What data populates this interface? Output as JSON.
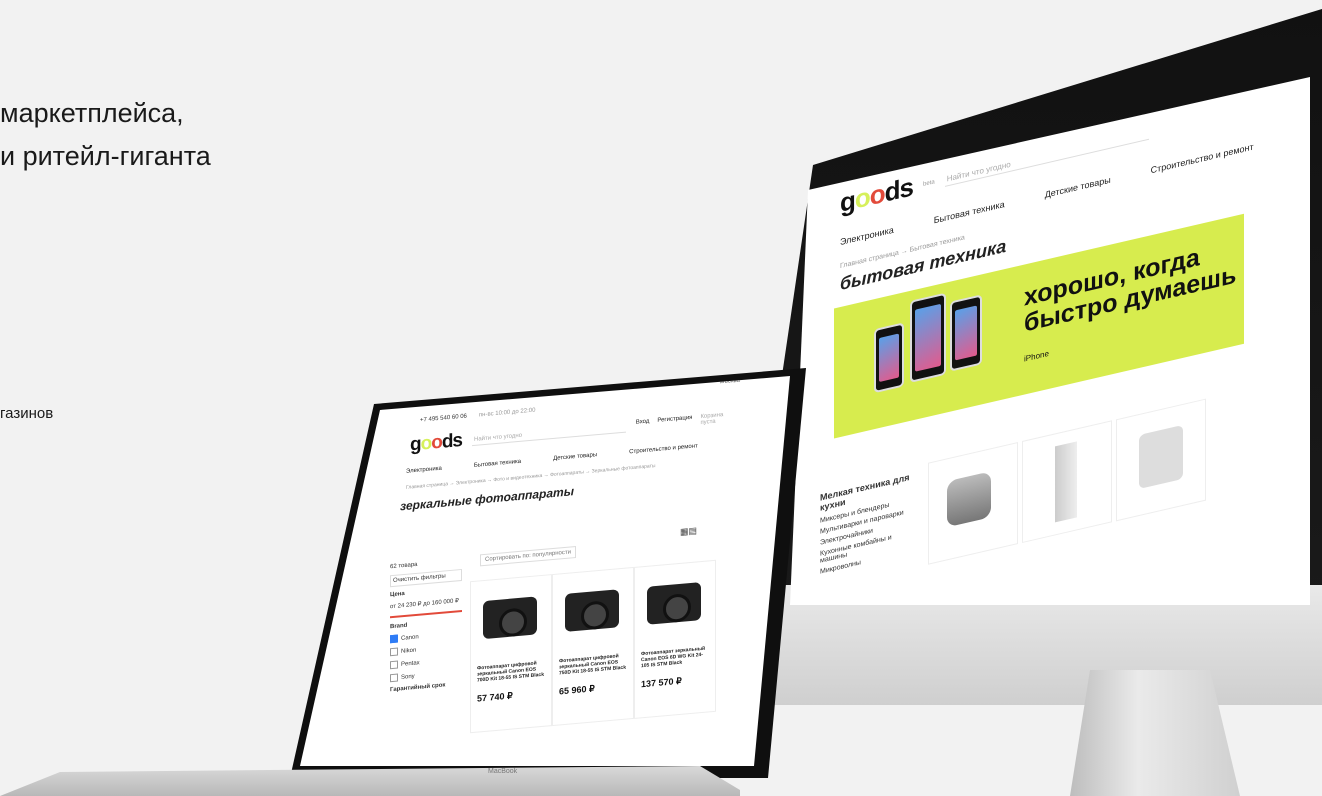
{
  "intro": {
    "line1": "маркетплейса,",
    "line2": "и ритейл-гиганта",
    "note": "газинов"
  },
  "store": {
    "phone": "+7 495 540 60 06",
    "hours": "пн-вс 10:00 до 22:00",
    "city": "Москва",
    "logo": "goods",
    "logo_badge": "beta",
    "search_placeholder": "Найти что угодно",
    "login": "Вход",
    "register": "Регистрация",
    "cart": "Корзина пуста",
    "nav": [
      "Электроника",
      "Бытовая техника",
      "Детские товары",
      "Строительство и ремонт"
    ]
  },
  "imac_page": {
    "breadcrumb": "Главная страница → Бытовая техника",
    "title": "бытовая техника",
    "promo_line1": "хорошо, когда",
    "promo_line2": "быстро думаешь",
    "promo_caption": "iPhone",
    "category_head": "Мелкая техника для кухни",
    "categories": [
      "Миксеры и блендеры",
      "Мультиварки и пароварки",
      "Электрочайники",
      "Кухонные комбайны и машины",
      "Микроволны"
    ]
  },
  "macbook_page": {
    "breadcrumb": "Главная страница → Электроника → Фото и видеотехника → Фотоаппараты → Зеркальные фотоаппараты",
    "title": "зеркальные фотоаппараты",
    "count": "62 товара",
    "clear_filters": "Очистить фильтры",
    "price_label": "Цена",
    "price_from": "от 24 230 ₽",
    "price_to": "до 160 000 ₽",
    "brand_label": "Brand",
    "brands": [
      "Canon",
      "Nikon",
      "Pentax",
      "Sony"
    ],
    "extra_filter": "Гарантийный срок",
    "sort": "Сортировать по: популярности",
    "cards": [
      {
        "name": "Фотоаппарат цифровой зеркальный Canon EOS 700D Kit 18-55 IS STM Black",
        "price": "57 740 ₽"
      },
      {
        "name": "Фотоаппарат цифровой зеркальный Canon EOS 750D Kit 18-55 IS STM Black",
        "price": "65 960 ₽"
      },
      {
        "name": "Фотоаппарат зеркальный Canon EOS 6D WG Kit 24-105 IS STM Black",
        "price": "137 570 ₽"
      }
    ],
    "laptop_label": "MacBook"
  },
  "colors": {
    "accent": "#d7ec4e",
    "brand_red": "#e24a3a",
    "check_blue": "#2f7cf6"
  }
}
